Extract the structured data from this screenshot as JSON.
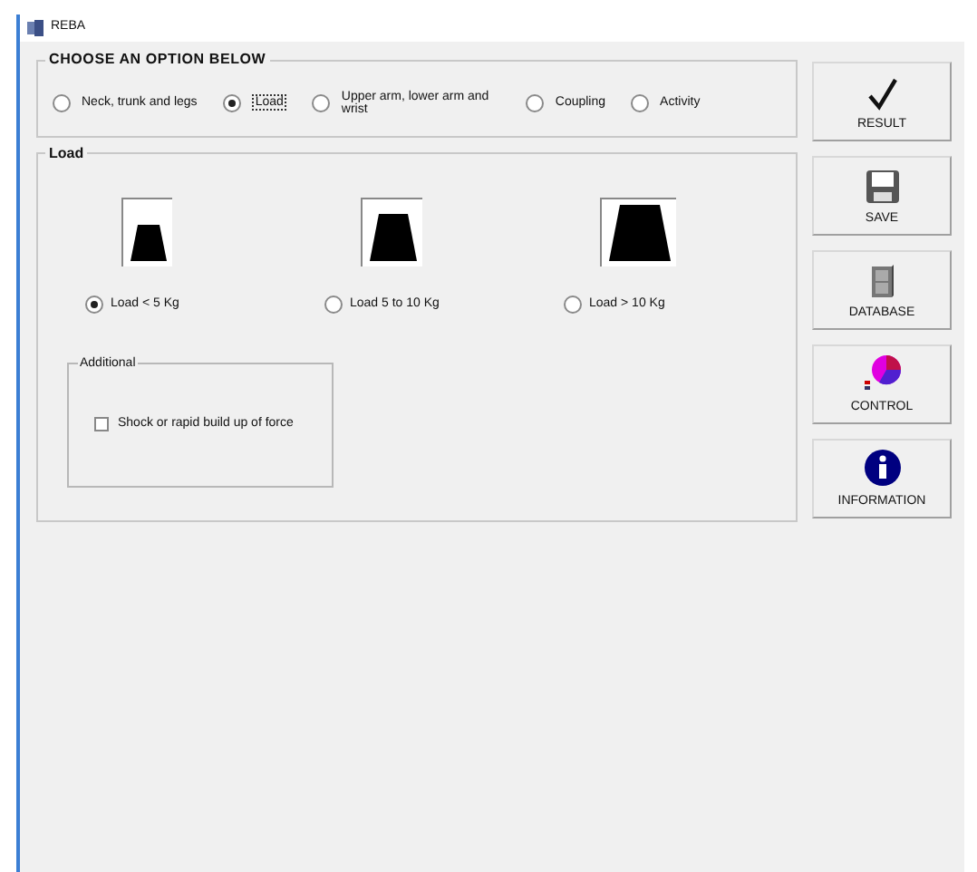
{
  "window": {
    "title": "REBA"
  },
  "options": {
    "title": "CHOOSE AN OPTION BELOW",
    "items": [
      {
        "label": "Neck, trunk and legs",
        "selected": false
      },
      {
        "label": "Load",
        "selected": true
      },
      {
        "label": "Upper arm, lower arm and wrist",
        "selected": false
      },
      {
        "label": "Coupling",
        "selected": false
      },
      {
        "label": "Activity",
        "selected": false
      }
    ]
  },
  "load": {
    "title": "Load",
    "items": [
      {
        "label": "Load < 5 Kg",
        "selected": true,
        "kind": "small"
      },
      {
        "label": "Load 5 to 10 Kg",
        "selected": false,
        "kind": "medium"
      },
      {
        "label": "Load > 10 Kg",
        "selected": false,
        "kind": "large"
      }
    ],
    "additional": {
      "title": "Additional",
      "checkbox": {
        "label": "Shock or rapid build up of force",
        "checked": false
      }
    }
  },
  "buttons": [
    {
      "label": "RESULT",
      "kind": "result"
    },
    {
      "label": "SAVE",
      "kind": "save"
    },
    {
      "label": "DATABASE",
      "kind": "database"
    },
    {
      "label": "CONTROL",
      "kind": "control"
    },
    {
      "label": "INFORMATION",
      "kind": "information"
    }
  ]
}
